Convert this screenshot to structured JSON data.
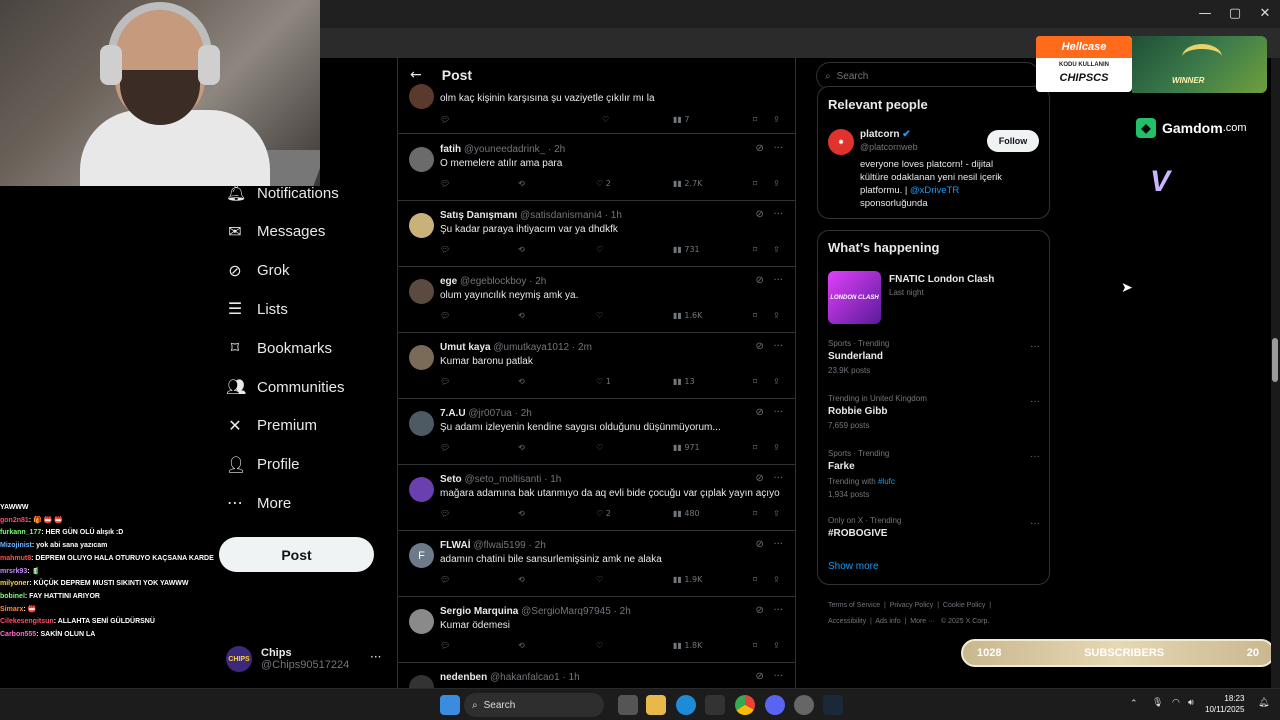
{
  "window": {
    "minimize": "—",
    "maximize": "▢",
    "close": "✕"
  },
  "nav": {
    "items": [
      {
        "label": "Notifications",
        "icon": "bell-icon"
      },
      {
        "label": "Messages",
        "icon": "envelope-icon"
      },
      {
        "label": "Grok",
        "icon": "grok-icon"
      },
      {
        "label": "Lists",
        "icon": "list-icon"
      },
      {
        "label": "Bookmarks",
        "icon": "bookmark-icon"
      },
      {
        "label": "Communities",
        "icon": "people-icon"
      },
      {
        "label": "Premium",
        "icon": "x-logo-icon"
      },
      {
        "label": "Profile",
        "icon": "person-icon"
      },
      {
        "label": "More",
        "icon": "more-circle-icon"
      }
    ],
    "post_label": "Post",
    "account": {
      "name": "Chips",
      "handle": "@Chips90517224",
      "avatar_text": "CHIPS"
    }
  },
  "chat": {
    "header": "YAWWW",
    "lines": [
      {
        "user": "gon2n81",
        "msg": ": 🎁 📛 📛",
        "color": "#ff4d6d"
      },
      {
        "user": "furkann_177",
        "msg": ": HER GÜN OLÜ alışık :D",
        "color": "#7cff6b"
      },
      {
        "user": "Mizojinist",
        "msg": ": yok abi sana yazıcam",
        "color": "#6bb6ff"
      },
      {
        "user": "mahmut8",
        "msg": ": DEPREM OLUYO HALA OTURUYO KAÇSANA KARDEŞİM",
        "color": "#ff5050"
      },
      {
        "user": "mrsrk93",
        "msg": ": 🧃",
        "color": "#c78aff"
      },
      {
        "user": "milyoner",
        "msg": ": KÜÇÜK DEPREM MUSTI SIKINTI YOK YAWWW",
        "color": "#ffd23a"
      },
      {
        "user": "bobinel",
        "msg": ": FAY HATTINI ARIYOR",
        "color": "#7cff6b"
      },
      {
        "user": "Simarx",
        "msg": ": 📛",
        "color": "#ff8c3a"
      },
      {
        "user": "Cilekesengitsun",
        "msg": ": ALLAHTA SENİ GÜLDÜRSNÜ",
        "color": "#ff4d6d"
      },
      {
        "user": "Carbon555",
        "msg": ": SAKİN OLUN LA",
        "color": "#ff6bd5"
      }
    ]
  },
  "center": {
    "title": "Post",
    "top_reply": {
      "text": "olm kaç kişinin karşısına şu vaziyetle çıkılır mı la",
      "views": "7"
    },
    "replies": [
      {
        "name": "fatih",
        "handle": "@youneedadrink_",
        "time": "· 2h",
        "text": "O memelere atılır ama para",
        "likes": "2",
        "views": "2.7K",
        "avatar": "#6b6b6b"
      },
      {
        "name": "Satış Danışmanı",
        "handle": "@satisdanismani4",
        "time": "· 1h",
        "text": "Şu kadar paraya ihtiyacım var ya dhdkfk",
        "likes": "",
        "views": "731",
        "avatar": "#c9b27a"
      },
      {
        "name": "ege",
        "handle": "@egeblockboy",
        "time": "· 2h",
        "text": "olum yayıncılık neymiş amk ya.",
        "likes": "",
        "views": "1.6K",
        "avatar": "#5a4a3f"
      },
      {
        "name": "Umut kaya",
        "handle": "@umutkaya1012",
        "time": "· 2m",
        "text": "Kumar baronu patlak",
        "likes": "1",
        "views": "13",
        "avatar": "#7a6a58"
      },
      {
        "name": "7.A.U",
        "handle": "@jr007ua",
        "time": "· 2h",
        "text": "Şu adamı izleyenin kendine saygısı olduğunu düşünmüyorum...",
        "likes": "",
        "views": "971",
        "avatar": "#4d5a63"
      },
      {
        "name": "Seto",
        "handle": "@seto_moltisanti",
        "time": "· 1h",
        "text": "mağara adamına bak utanmıyo da aq evli bide çocuğu var çıplak yayın açıyo",
        "likes": "2",
        "views": "480",
        "avatar": "#6a3fb0"
      },
      {
        "name": "FLWAİ",
        "handle": "@flwai5199",
        "time": "· 2h",
        "text": "adamın chatini bile sansurlemişsiniz amk ne alaka",
        "likes": "",
        "views": "1.9K",
        "avatar": "#6c7a89"
      },
      {
        "name": "Sergio Marquina",
        "handle": "@SergioMarq97945",
        "time": "· 2h",
        "text": "Kumar ödemesi",
        "likes": "",
        "views": "1.8K",
        "avatar": "#8a8a8a"
      },
      {
        "name": "nedenben",
        "handle": "@hakanfalcao1",
        "time": "· 1h",
        "text": "",
        "likes": "",
        "views": "",
        "avatar": "#333"
      }
    ],
    "avatar_letter_flwai": "F"
  },
  "right": {
    "search_placeholder": "Search",
    "relevant": {
      "title": "Relevant people",
      "name": "platcorn",
      "handle": "@platcornweb",
      "follow": "Follow",
      "bio_1": "everyone loves platcorn! - dijital",
      "bio_2": "kültüre odaklanan yeni nesil içerik",
      "bio_3": "platformu. |",
      "bio_link": "@xDriveTR",
      "bio_4": "sponsorluğunda"
    },
    "happening": {
      "title": "What’s happening",
      "event_name": "FNATIC London Clash",
      "event_time": "Last night",
      "event_thumb_text": "LONDON CLASH",
      "trends": [
        {
          "meta": "Sports · Trending",
          "name": "Sunderland",
          "count": "23.9K posts",
          "extra": ""
        },
        {
          "meta": "Trending in United Kingdom",
          "name": "Robbie Gibb",
          "count": "7,659 posts",
          "extra": ""
        },
        {
          "meta": "Sports · Trending",
          "name": "Farke",
          "count": "1,934 posts",
          "extra_prefix": "Trending with",
          "extra": "#lufc"
        },
        {
          "meta": "Only on X · Trending",
          "name": "#ROBOGIVE",
          "count": "",
          "extra": ""
        }
      ],
      "show_more": "Show more"
    },
    "footer": {
      "l1": "Terms of Service",
      "l2": "Privacy Policy",
      "l3": "Cookie Policy",
      "l4": "Accessibility",
      "l5": "Ads info",
      "l6": "More ···",
      "l7": "© 2025 X Corp."
    }
  },
  "overlay": {
    "hellcase": "Hellcase",
    "hellcase_sub1": "KODU KULLANIN",
    "hellcase_sub2": "CHIPSCS",
    "winner": "WINNER",
    "gamdom": "Gamdom",
    "gamdom_suffix": ".com",
    "subs_left": "1028",
    "subs_label": "SUBSCRIBERS",
    "subs_right": "20"
  },
  "taskbar": {
    "search": "Search",
    "time": "18:23",
    "date": "10/11/2025"
  }
}
